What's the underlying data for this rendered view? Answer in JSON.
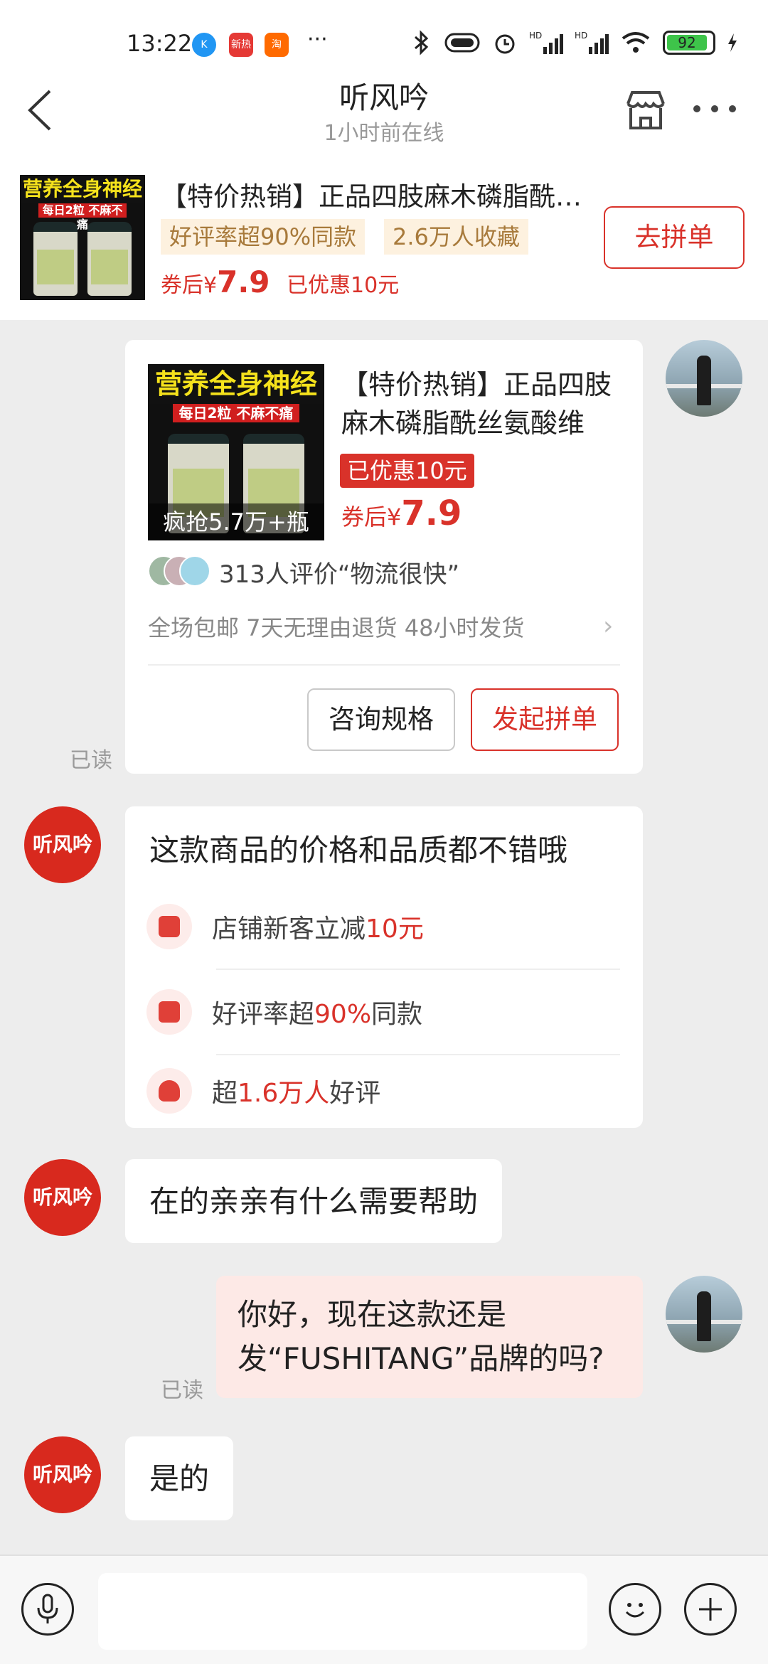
{
  "status_bar": {
    "time": "13:22",
    "battery": "92",
    "app_icons": [
      {
        "name": "k-app-icon",
        "label": "K",
        "color": "#2196f3"
      },
      {
        "name": "hot-news-icon",
        "label": "新热",
        "color": "#e53935"
      },
      {
        "name": "taobao-icon",
        "label": "淘",
        "color": "#ff6a00"
      }
    ],
    "more": "···"
  },
  "header": {
    "title": "听风吟",
    "subtitle": "1小时前在线"
  },
  "product_banner": {
    "image_top": "营养全身神经",
    "image_sub": "每日2粒 不麻不痛",
    "title": "【特价热销】正品四肢麻木磷脂酰丝氨酸维",
    "tag1": "好评率超90%同款",
    "tag2": "2.6万人收藏",
    "price_prefix": "券后",
    "currency": "¥",
    "price": "7.9",
    "discount": "已优惠10元",
    "button": "去拼单"
  },
  "product_card": {
    "image_top": "营养全身神经",
    "image_sub": "每日2粒 不麻不痛",
    "image_overlay": "疯抢5.7万+瓶",
    "title": "【特价热销】正品四肢麻木磷脂酰丝氨酸维",
    "badge": "已优惠10元",
    "price_prefix": "券后",
    "currency": "¥",
    "price": "7.9",
    "review": "313人评价“物流很快”",
    "perks": "全场包邮  7天无理由退货  48小时发货",
    "btn_consult": "咨询规格",
    "btn_group": "发起拼单",
    "read": "已读"
  },
  "shop_avatar_label": "听风吟",
  "info_bubble": {
    "title": "这款商品的价格和品质都不错哦",
    "rows": [
      {
        "pre": "店铺新客立减",
        "hl": "10元",
        "post": ""
      },
      {
        "pre": "好评率超",
        "hl": "90%",
        "post": "同款"
      },
      {
        "pre": "超",
        "hl": "1.6万人",
        "post": "好评"
      }
    ]
  },
  "messages": {
    "shop_1": "在的亲亲有什么需要帮助",
    "user_1": "你好，现在这款还是发“FUSHITANG”品牌的吗?",
    "user_1_read": "已读",
    "shop_2": "是的"
  },
  "input_bar": {
    "placeholder": ""
  },
  "colors": {
    "accent": "#d9322a",
    "bg": "#ededed"
  }
}
